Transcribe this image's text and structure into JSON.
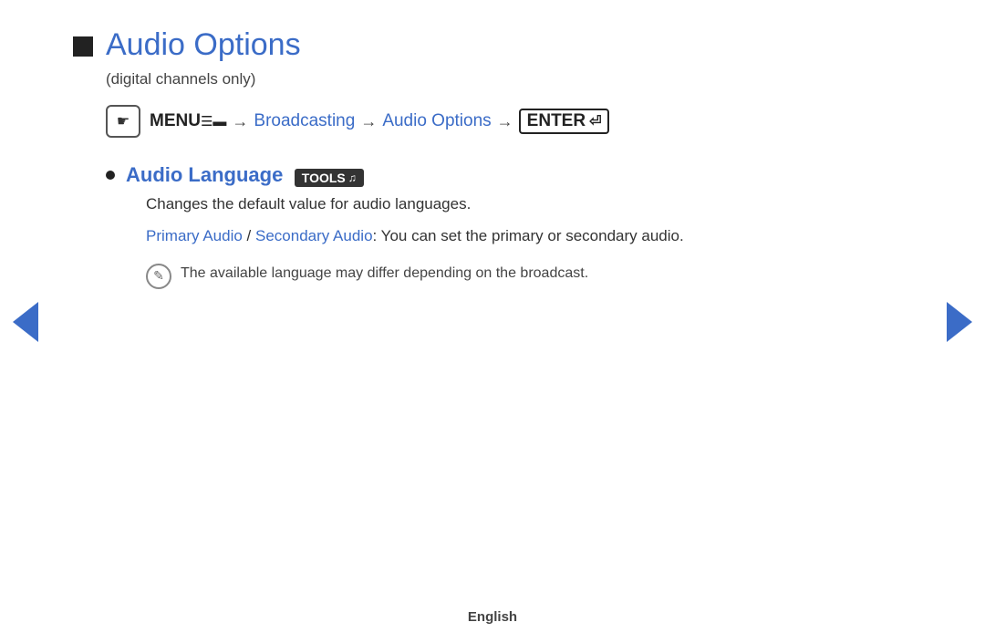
{
  "page": {
    "title": "Audio Options",
    "subtitle": "(digital channels only)",
    "nav": {
      "menu_label": "MENU",
      "menu_symbol": "≡",
      "arrow": "→",
      "broadcasting": "Broadcasting",
      "audio_options": "Audio Options",
      "enter_label": "ENTER"
    },
    "sections": [
      {
        "label": "Audio Language",
        "badge": "TOOLS",
        "description": "Changes the default value for audio languages.",
        "detail_primary": "Primary Audio",
        "detail_slash": " / ",
        "detail_secondary": "Secondary Audio",
        "detail_suffix": ": You can set the primary or secondary audio."
      }
    ],
    "note": "The available language may differ depending on the broadcast.",
    "footer": "English"
  },
  "nav_arrows": {
    "left": "◀",
    "right": "▶"
  }
}
